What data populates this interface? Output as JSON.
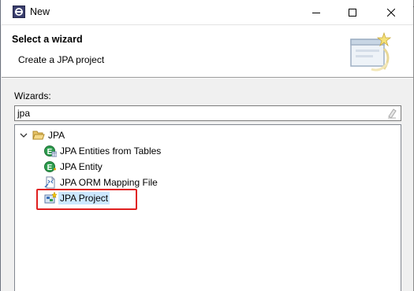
{
  "window": {
    "title": "New"
  },
  "header": {
    "title": "Select a wizard",
    "description": "Create a JPA project"
  },
  "body": {
    "wizards_label": "Wizards:",
    "filter_value": "jpa"
  },
  "tree": {
    "category": {
      "label": "JPA",
      "expanded": true,
      "icon": "folder-open-icon"
    },
    "items": [
      {
        "label": "JPA Entities from Tables",
        "icon": "jpa-entity-gen-icon",
        "selected": false
      },
      {
        "label": "JPA Entity",
        "icon": "jpa-entity-icon",
        "selected": false
      },
      {
        "label": "JPA ORM Mapping File",
        "icon": "orm-file-icon",
        "selected": false
      },
      {
        "label": "JPA Project",
        "icon": "jpa-project-icon",
        "selected": true
      }
    ]
  },
  "colors": {
    "selection": "#cce8ff",
    "highlight_border": "#e02020"
  }
}
